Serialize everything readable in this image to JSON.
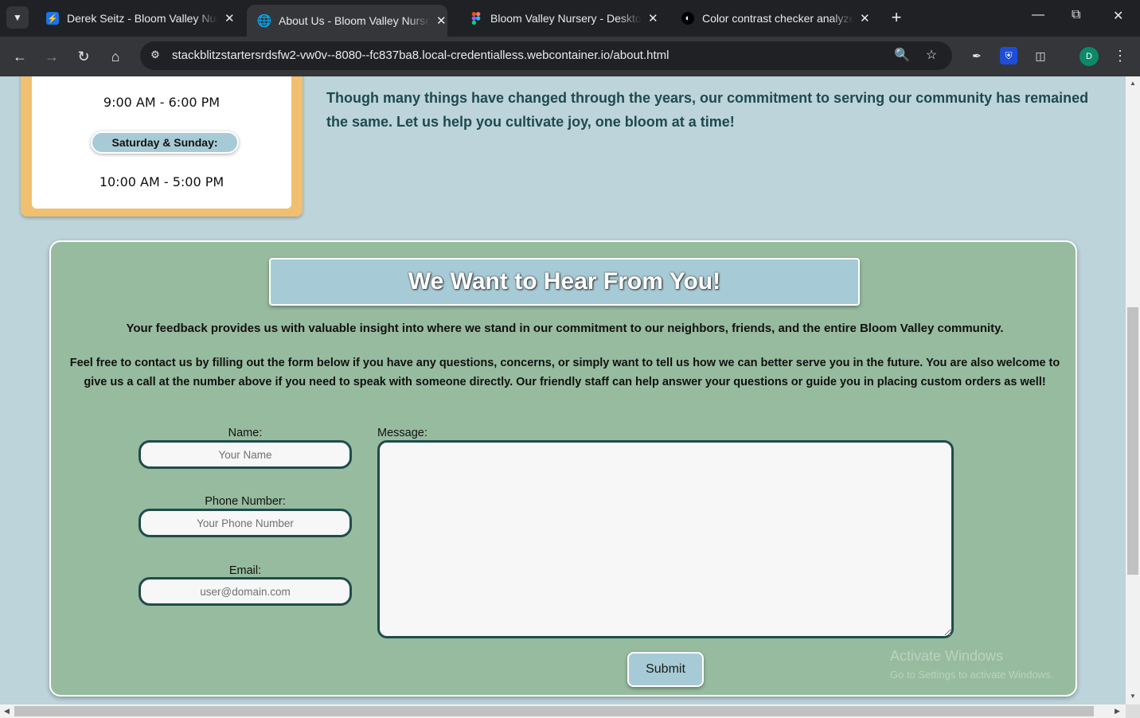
{
  "browser": {
    "tabs": [
      {
        "title": "Derek Seitz - Bloom Valley Nursery",
        "icon": "bolt-icon",
        "color": "#1a73e8"
      },
      {
        "title": "About Us - Bloom Valley Nursery",
        "icon": "globe-icon",
        "active": true
      },
      {
        "title": "Bloom Valley Nursery - Desktop",
        "icon": "figma-icon"
      },
      {
        "title": "Color contrast checker analyzer",
        "icon": "contrast-icon"
      }
    ],
    "url": "stackblitzstartersrdsfw2-vw0v--8080--fc837ba8.local-credentialless.webcontainer.io/about.html",
    "profile_initial": "D"
  },
  "hours": {
    "weekday_time": "9:00 AM - 6:00 PM",
    "weekend_label": "Saturday & Sunday:",
    "weekend_time": "10:00 AM - 5:00 PM"
  },
  "intro": {
    "text": "Though many things have changed through the years, our commitment to serving our community has remained the same. Let us help you cultivate joy, one bloom at a time!"
  },
  "contact": {
    "heading": "We Want to Hear From You!",
    "paragraph1": "Your feedback provides us with valuable insight into where we stand in our commitment to our neighbors, friends, and the entire Bloom Valley community.",
    "paragraph2": "Feel free to contact us by filling out the form below if you have any questions, concerns, or simply want to tell us how we can better serve you in the future. You are also welcome to give us a call at the number above if you need to speak with someone directly. Our friendly staff can help answer your questions or guide you in placing custom orders as well!",
    "form": {
      "name_label": "Name:",
      "name_placeholder": "Your Name",
      "phone_label": "Phone Number:",
      "phone_placeholder": "Your Phone Number",
      "email_label": "Email:",
      "email_placeholder": "user@domain.com",
      "message_label": "Message:",
      "message_value": "",
      "submit_label": "Submit"
    }
  },
  "watermark": {
    "line1": "Activate Windows",
    "line2": "Go to Settings to activate Windows."
  },
  "colors": {
    "page_background": "#bcd4da",
    "contact_background": "#97bb9e",
    "accent_blue": "#a7cbd6",
    "hours_border": "#f0c070",
    "input_border": "#1f4c4c",
    "intro_text": "#1e4a4f"
  }
}
